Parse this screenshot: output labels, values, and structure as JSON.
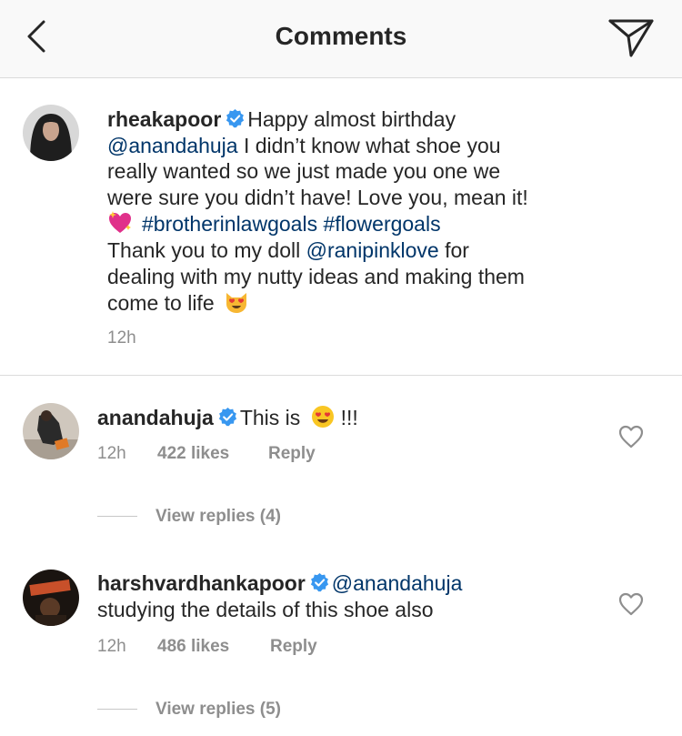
{
  "header": {
    "title": "Comments",
    "back_icon": "chevron-left-icon",
    "share_icon": "paper-plane-icon"
  },
  "caption": {
    "username": "rheakapoor",
    "verified": true,
    "line1_text": "Happy almost birthday",
    "mention1": "@anandahuja",
    "line2_text": " I didn’t know what shoe you",
    "line3_text": "really wanted so we just made you one we",
    "line4_text": "were sure you didn’t have! Love you, mean it!",
    "hashtags": "#brotherinlawgoals #flowergoals",
    "line6_text": "Thank you to my doll ",
    "mention2": "@ranipinklove",
    "line6_tail": " for",
    "line7_text": "dealing with my nutty ideas and making them",
    "line8_text": "come to life",
    "time": "12h"
  },
  "comments": [
    {
      "username": "anandahuja",
      "verified": true,
      "text_before": "This is",
      "text_after": "!!!",
      "time": "12h",
      "likes": "422 likes",
      "reply": "Reply",
      "view_replies": "View replies (4)"
    },
    {
      "username": "harshvardhankapoor",
      "verified": true,
      "mention": "@anandahuja",
      "text": "studying the details of this shoe also",
      "time": "12h",
      "likes": "486 likes",
      "reply": "Reply",
      "view_replies": "View replies (5)"
    }
  ],
  "colors": {
    "link": "#003569",
    "verified": "#3897f0",
    "meta": "#8e8e8e",
    "divider": "#dbdbdb"
  }
}
